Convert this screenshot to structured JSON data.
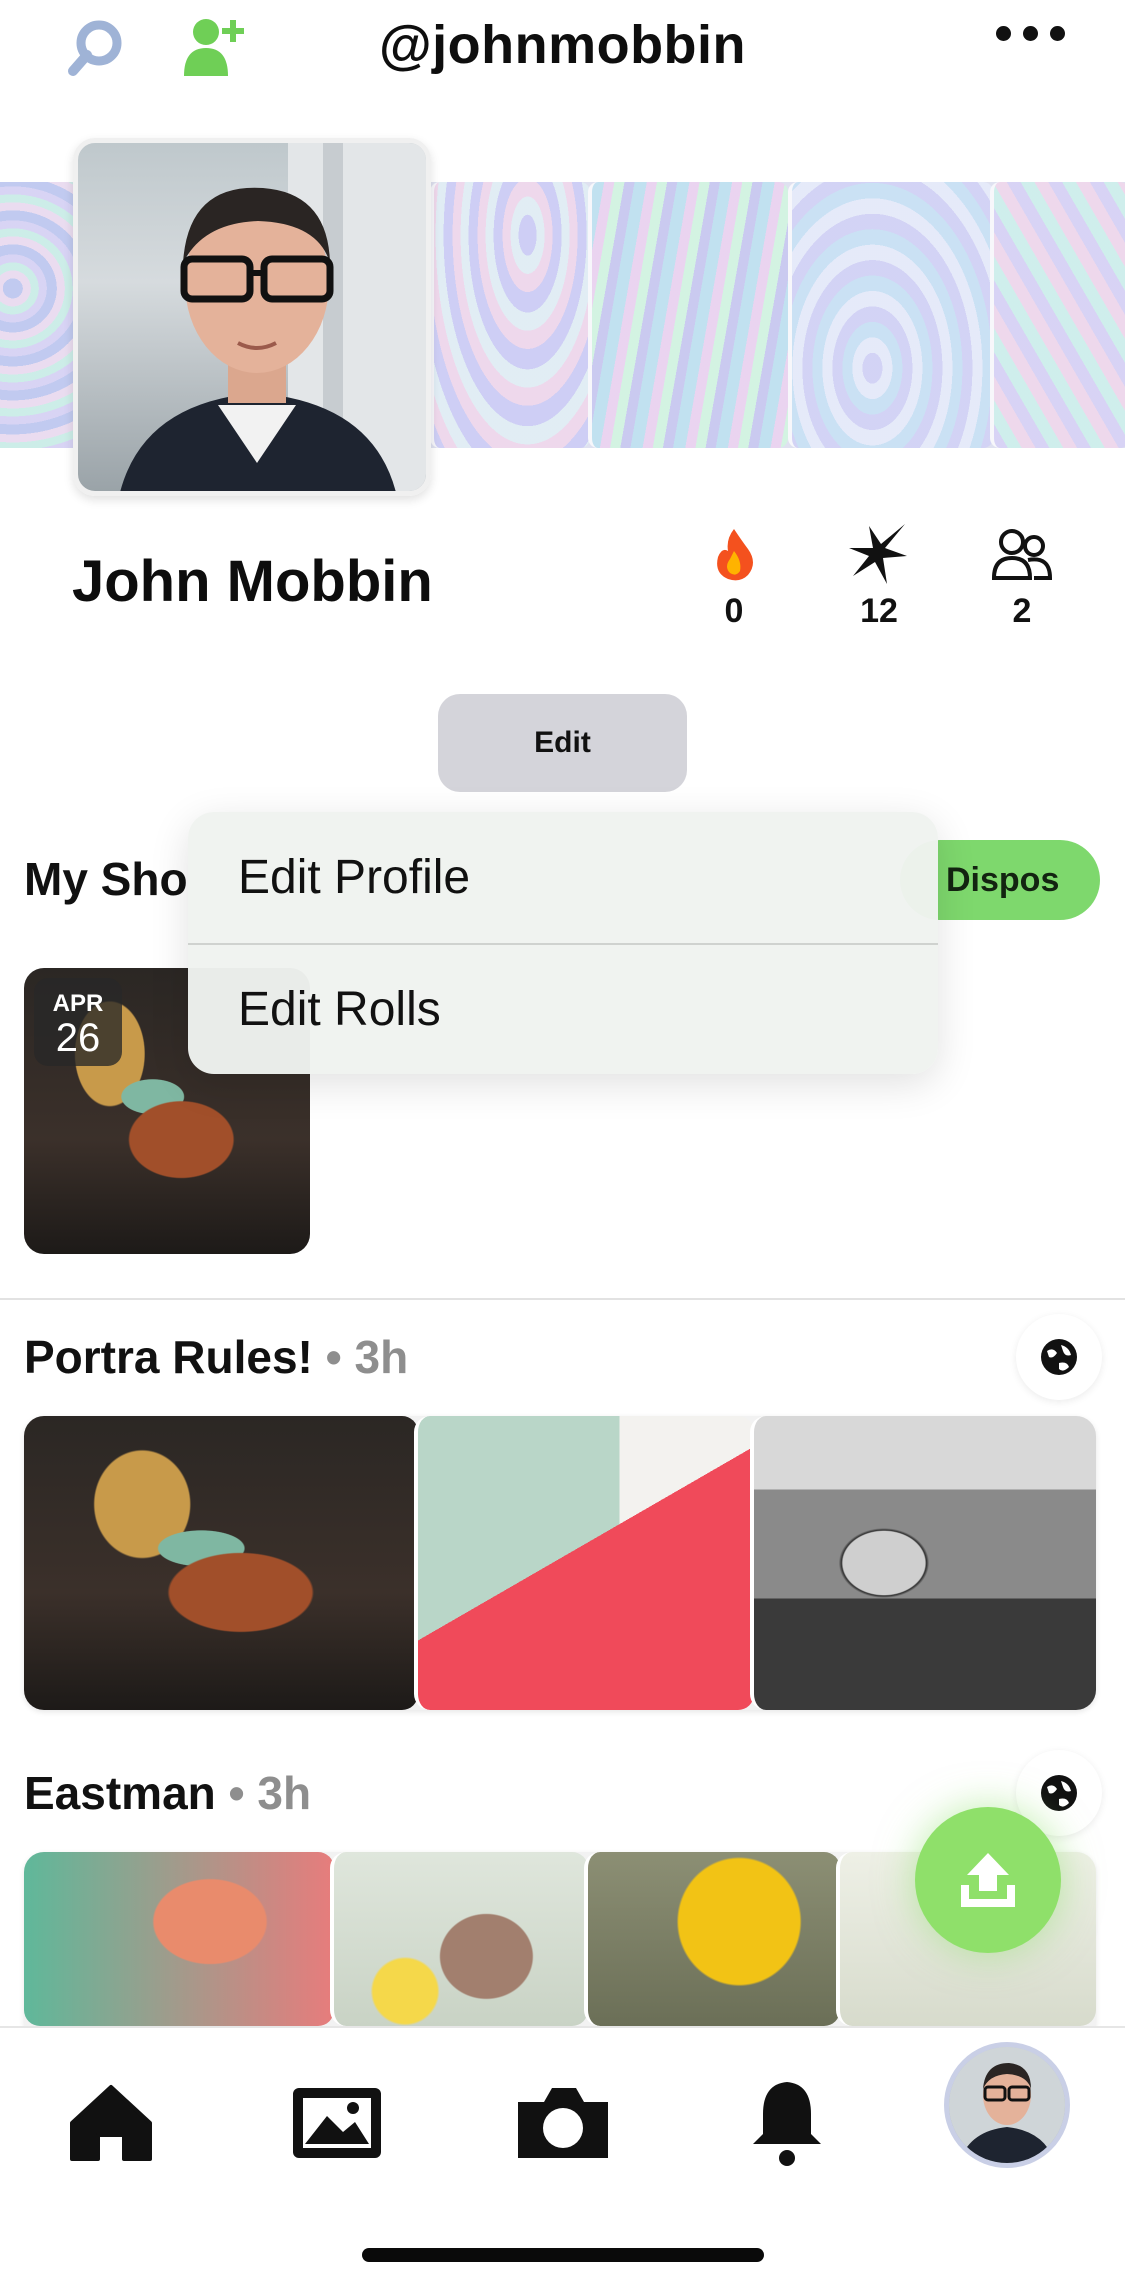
{
  "header": {
    "handle": "@johnmobbin",
    "search_icon": "search-icon",
    "add_friend_icon": "add-friend-icon",
    "more_icon": "more-icon"
  },
  "profile": {
    "name": "John Mobbin",
    "stats": [
      {
        "icon": "fire-icon",
        "value": "0"
      },
      {
        "icon": "spark-icon",
        "value": "12"
      },
      {
        "icon": "friends-icon",
        "value": "2"
      }
    ],
    "edit_label": "Edit"
  },
  "edit_menu": {
    "items": [
      "Edit Profile",
      "Edit Rolls"
    ]
  },
  "shots": {
    "title": "My Sho",
    "pill_label": "Dispos",
    "date_badge": {
      "month": "APR",
      "day": "26"
    }
  },
  "rolls": [
    {
      "title": "Portra Rules!",
      "time": "3h"
    },
    {
      "title": "Eastman",
      "time": "3h"
    }
  ],
  "colors": {
    "accent_green": "#7ed86d",
    "fab_green": "#8fe06a",
    "fire": "#f4511e"
  },
  "tabbar": {
    "items": [
      "home-icon",
      "gallery-icon",
      "camera-icon",
      "bell-icon",
      "profile-avatar"
    ]
  }
}
